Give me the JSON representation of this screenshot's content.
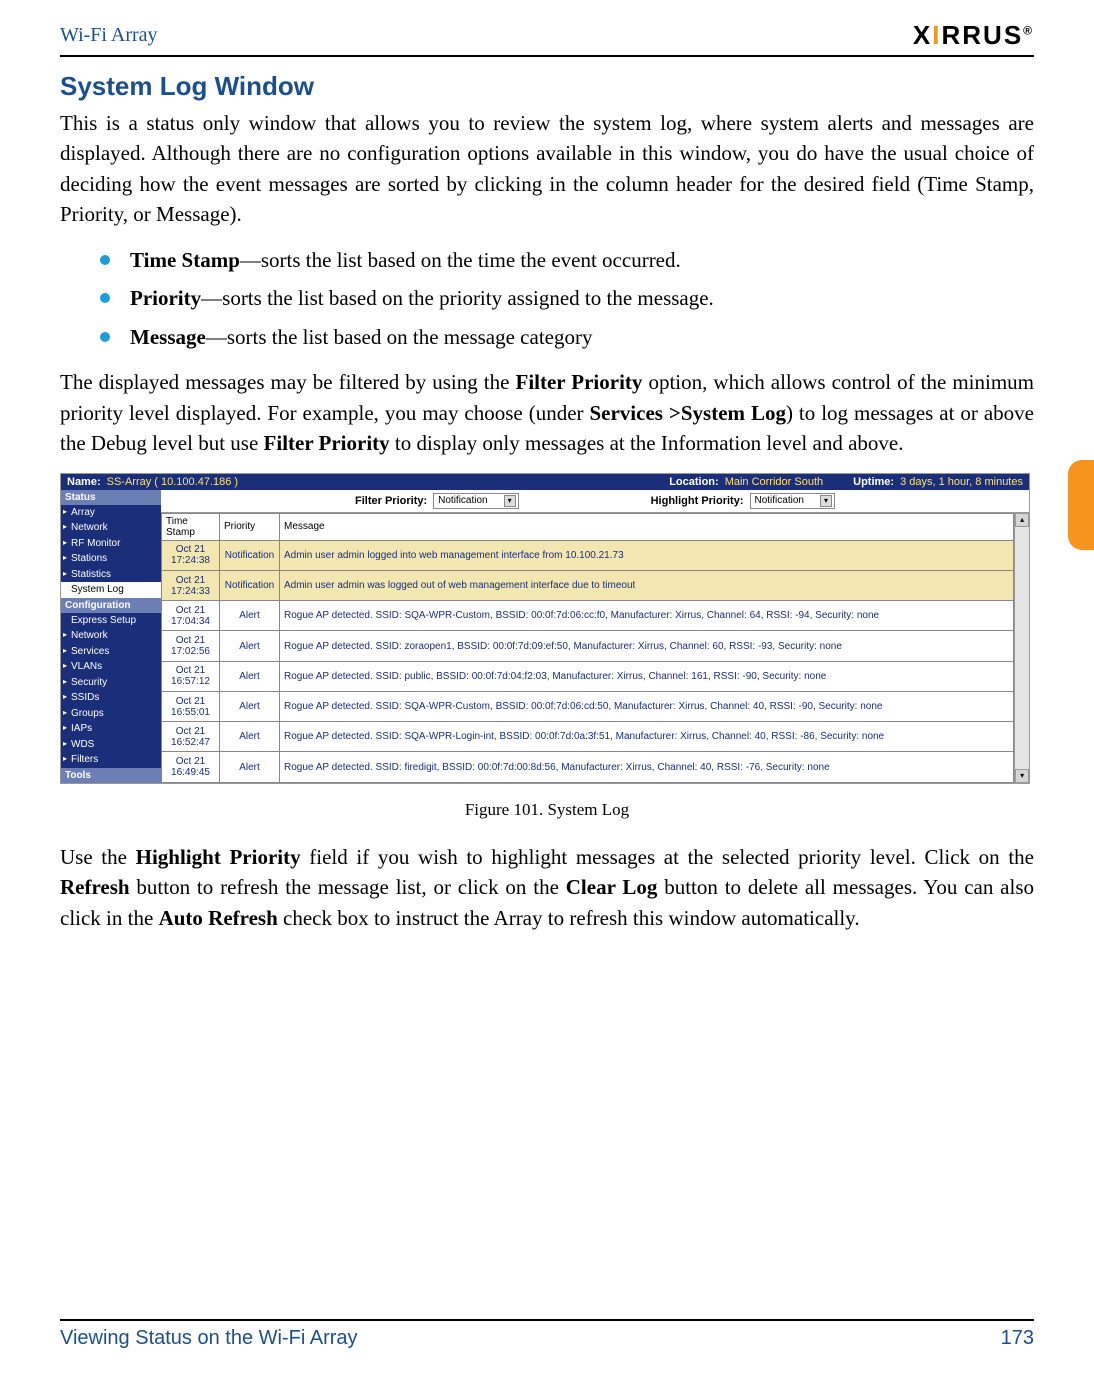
{
  "header": {
    "product": "Wi-Fi Array",
    "logo_text_pre": "X",
    "logo_text_mid": "I",
    "logo_text_post": "RRUS",
    "reg": "®"
  },
  "section_title": "System Log Window",
  "intro": "This is a status only window that allows you to review the system log, where system alerts and messages are displayed. Although there are no configuration options available in this window, you do have the usual choice of deciding how the event messages are sorted by clicking in the column header for the desired field (Time Stamp, Priority, or Message).",
  "bullets": [
    {
      "term": "Time Stamp",
      "desc": "—sorts the list based on the time the event occurred."
    },
    {
      "term": "Priority",
      "desc": "—sorts the list based on the priority assigned to the message."
    },
    {
      "term": "Message",
      "desc": "—sorts the list based on the message category"
    }
  ],
  "para2_a": "The displayed messages may be filtered by using the ",
  "para2_b": "Filter Priority",
  "para2_c": " option, which allows control of the minimum priority level displayed. For example, you may choose (under ",
  "para2_d": "Services >System Log",
  "para2_e": ") to log messages at or above the Debug level but use ",
  "para2_f": "Filter Priority",
  "para2_g": " to display only messages at the Information level and above.",
  "figure_caption": "Figure 101. System Log",
  "para3_a": "Use the ",
  "para3_b": "Highlight Priority",
  "para3_c": " field if you wish to highlight messages at the selected priority level. Click on the ",
  "para3_d": "Refresh",
  "para3_e": " button to refresh the message list, or click on the ",
  "para3_f": "Clear Log",
  "para3_g": " button to delete all messages. You can also click in the ",
  "para3_h": "Auto Refresh",
  "para3_i": " check box to instruct the Array to refresh this window automatically.",
  "footer": {
    "left": "Viewing Status on the Wi-Fi Array",
    "right": "173"
  },
  "screenshot": {
    "topbar": {
      "name_lbl": "Name:",
      "name_val": "SS-Array   ( 10.100.47.186 )",
      "loc_lbl": "Location:",
      "loc_val": "Main Corridor South",
      "up_lbl": "Uptime:",
      "up_val": "3 days, 1 hour, 8 minutes"
    },
    "nav": {
      "groups": [
        {
          "header": "Status",
          "items": [
            {
              "label": "Array",
              "arrow": true
            },
            {
              "label": "Network",
              "arrow": true
            },
            {
              "label": "RF Monitor",
              "arrow": true
            },
            {
              "label": "Stations",
              "arrow": true
            },
            {
              "label": "Statistics",
              "arrow": true
            },
            {
              "label": "System Log",
              "sel": true
            }
          ]
        },
        {
          "header": "Configuration",
          "items": [
            {
              "label": "Express Setup"
            },
            {
              "label": "Network",
              "arrow": true
            },
            {
              "label": "Services",
              "arrow": true
            },
            {
              "label": "VLANs",
              "arrow": true
            },
            {
              "label": "Security",
              "arrow": true
            },
            {
              "label": "SSIDs",
              "arrow": true
            },
            {
              "label": "Groups",
              "arrow": true
            },
            {
              "label": "IAPs",
              "arrow": true
            },
            {
              "label": "WDS",
              "arrow": true
            },
            {
              "label": "Filters",
              "arrow": true
            }
          ]
        },
        {
          "header": "Tools",
          "items": []
        }
      ]
    },
    "filters": {
      "filter_lbl": "Filter Priority:",
      "filter_val": "Notification",
      "hl_lbl": "Highlight Priority:",
      "hl_val": "Notification"
    },
    "columns": [
      "Time Stamp",
      "Priority",
      "Message"
    ],
    "rows": [
      {
        "ts": "Oct 21 17:24:38",
        "pr": "Notification",
        "msg": "Admin user admin logged into web management interface from 10.100.21.73",
        "hl": true
      },
      {
        "ts": "Oct 21 17:24:33",
        "pr": "Notification",
        "msg": "Admin user admin was logged out of web management interface due to timeout",
        "hl": true
      },
      {
        "ts": "Oct 21 17:04:34",
        "pr": "Alert",
        "msg": "Rogue AP detected. SSID: SQA-WPR-Custom, BSSID: 00:0f:7d:06:cc:f0, Manufacturer: Xirrus, Channel: 64, RSSI: -94, Security: none"
      },
      {
        "ts": "Oct 21 17:02:56",
        "pr": "Alert",
        "msg": "Rogue AP detected. SSID: zoraopen1, BSSID: 00:0f:7d:09:ef:50, Manufacturer: Xirrus, Channel: 60, RSSI: -93, Security: none"
      },
      {
        "ts": "Oct 21 16:57:12",
        "pr": "Alert",
        "msg": "Rogue AP detected. SSID: public, BSSID: 00:0f:7d:04:f2:03, Manufacturer: Xirrus, Channel: 161, RSSI: -90, Security: none"
      },
      {
        "ts": "Oct 21 16:55:01",
        "pr": "Alert",
        "msg": "Rogue AP detected. SSID: SQA-WPR-Custom, BSSID: 00:0f:7d:06:cd:50, Manufacturer: Xirrus, Channel: 40, RSSI: -90, Security: none"
      },
      {
        "ts": "Oct 21 16:52:47",
        "pr": "Alert",
        "msg": "Rogue AP detected. SSID: SQA-WPR-Login-int, BSSID: 00:0f:7d:0a:3f:51, Manufacturer: Xirrus, Channel: 40, RSSI: -86, Security: none"
      },
      {
        "ts": "Oct 21 16:49:45",
        "pr": "Alert",
        "msg": "Rogue AP detected. SSID: firedigit, BSSID: 00:0f:7d:00:8d:56, Manufacturer: Xirrus, Channel: 40, RSSI: -76, Security: none"
      }
    ]
  }
}
